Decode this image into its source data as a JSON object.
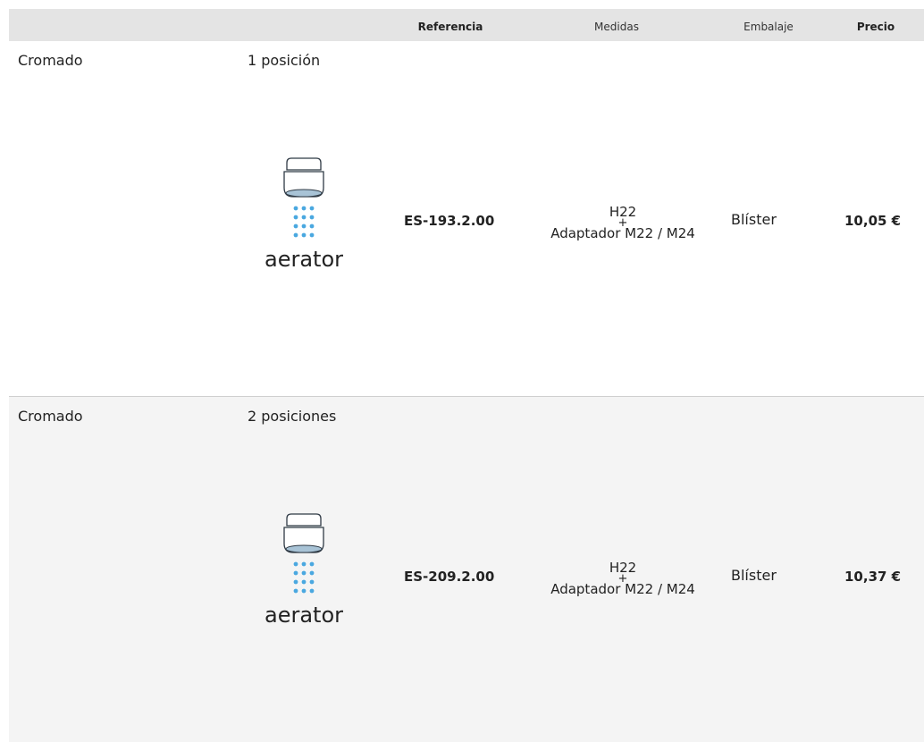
{
  "header": {
    "referencia": "Referencia",
    "medidas": "Medidas",
    "embalaje": "Embalaje",
    "precio": "Precio"
  },
  "rows": [
    {
      "finish": "Cromado",
      "variant": "1 posición",
      "image_caption": "aerator",
      "image_icon": "aerator-icon",
      "referencia": "ES-193.2.00",
      "medidas_line1": "H22",
      "medidas_plus": "+",
      "medidas_line2": "Adaptador M22 / M24",
      "embalaje": "Blíster",
      "precio": "10,05 €"
    },
    {
      "finish": "Cromado",
      "variant": "2 posiciones",
      "image_caption": "aerator",
      "image_icon": "aerator-icon",
      "referencia": "ES-209.2.00",
      "medidas_line1": "H22",
      "medidas_plus": "+",
      "medidas_line2": "Adaptador M22 / M24",
      "embalaje": "Blíster",
      "precio": "10,37 €"
    }
  ],
  "colors": {
    "header_bg": "#e4e4e4",
    "alt_row_bg": "#f4f4f4",
    "water_drops": "#4aa8e0",
    "icon_stroke": "#2f3a45"
  }
}
